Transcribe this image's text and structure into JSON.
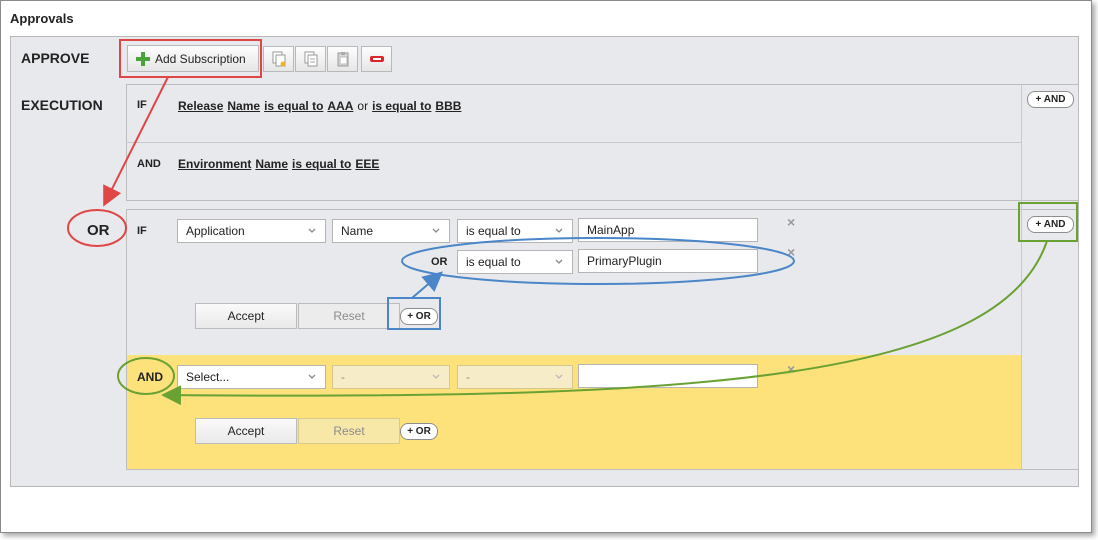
{
  "panel": {
    "title": "Approvals"
  },
  "approve": {
    "label": "APPROVE",
    "add_subscription_label": "Add Subscription"
  },
  "execution": {
    "label": "EXECUTION",
    "rows": [
      {
        "op": "IF",
        "parts": [
          {
            "t": "Release",
            "u": true
          },
          {
            "t": "Name",
            "u": true
          },
          {
            "t": "is equal to",
            "u": true
          },
          {
            "t": "AAA",
            "u": true
          },
          {
            "t": "or",
            "u": false
          },
          {
            "t": "is equal to",
            "u": true
          },
          {
            "t": "BBB",
            "u": true
          }
        ]
      },
      {
        "op": "AND",
        "parts": [
          {
            "t": "Environment",
            "u": true
          },
          {
            "t": "Name",
            "u": true
          },
          {
            "t": "is equal to",
            "u": true
          },
          {
            "t": "EEE",
            "u": true
          }
        ]
      }
    ],
    "and_button": "+ AND"
  },
  "or_block": {
    "or_label": "OR",
    "if_label": "IF",
    "field1": "Application",
    "field2": "Name",
    "operator": "is equal to",
    "value1": "MainApp",
    "or_row_label": "OR",
    "operator2": "is equal to",
    "value2": "PrimaryPlugin",
    "accept_label": "Accept",
    "reset_label": "Reset",
    "add_or_label": "+ OR",
    "and_button": "+ AND",
    "close_glyph": "×"
  },
  "and_block": {
    "and_label": "AND",
    "field1": "Select...",
    "field2": "-",
    "operator": "-",
    "value": "",
    "accept_label": "Accept",
    "reset_label": "Reset",
    "add_or_label": "+ OR",
    "close_glyph": "×"
  },
  "colors": {
    "red": "#e04646",
    "blue": "#4a86c8",
    "green": "#6aa133",
    "highlight": "#fde27c"
  },
  "icons": [
    "plus-icon",
    "copy-icon",
    "paste-icon",
    "clipboard-icon",
    "remove-icon",
    "chevron-down-icon",
    "close-icon"
  ]
}
